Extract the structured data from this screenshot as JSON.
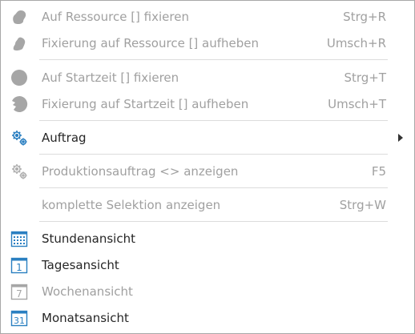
{
  "menu": {
    "items": [
      {
        "label": "Auf Ressource [] fixieren",
        "shortcut": "Strg+R",
        "icon": "pin-resource-icon",
        "enabled": false
      },
      {
        "label": "Fixierung auf Ressource [] aufheben",
        "shortcut": "Umsch+R",
        "icon": "unpin-resource-icon",
        "enabled": false
      },
      {
        "label": "Auf Startzeit [] fixieren",
        "shortcut": "Strg+T",
        "icon": "pin-starttime-icon",
        "enabled": false
      },
      {
        "label": "Fixierung auf Startzeit [] aufheben",
        "shortcut": "Umsch+T",
        "icon": "unpin-starttime-icon",
        "enabled": false
      },
      {
        "label": "Auftrag",
        "shortcut": "",
        "icon": "gears-icon",
        "enabled": true,
        "submenu": true
      },
      {
        "label": "Produktionsauftrag <> anzeigen",
        "shortcut": "F5",
        "icon": "gears-icon",
        "enabled": false
      },
      {
        "label": "komplette Selektion anzeigen",
        "shortcut": "Strg+W",
        "icon": "",
        "enabled": false
      },
      {
        "label": "Stundenansicht",
        "shortcut": "",
        "icon": "calendar-hours-icon",
        "enabled": true
      },
      {
        "label": "Tagesansicht",
        "shortcut": "",
        "icon": "calendar-day-icon",
        "icon_text": "1",
        "enabled": true
      },
      {
        "label": "Wochenansicht",
        "shortcut": "",
        "icon": "calendar-week-icon",
        "icon_text": "7",
        "enabled": false
      },
      {
        "label": "Monatsansicht",
        "shortcut": "",
        "icon": "calendar-month-icon",
        "icon_text": "31",
        "enabled": true
      }
    ]
  },
  "colors": {
    "text": "#262626",
    "disabled_text": "#a0a0a0",
    "separator": "#dcdcdc",
    "icon_blue": "#2a7fc1",
    "icon_gray": "#a6a6a6",
    "border": "#a8a8a8"
  }
}
